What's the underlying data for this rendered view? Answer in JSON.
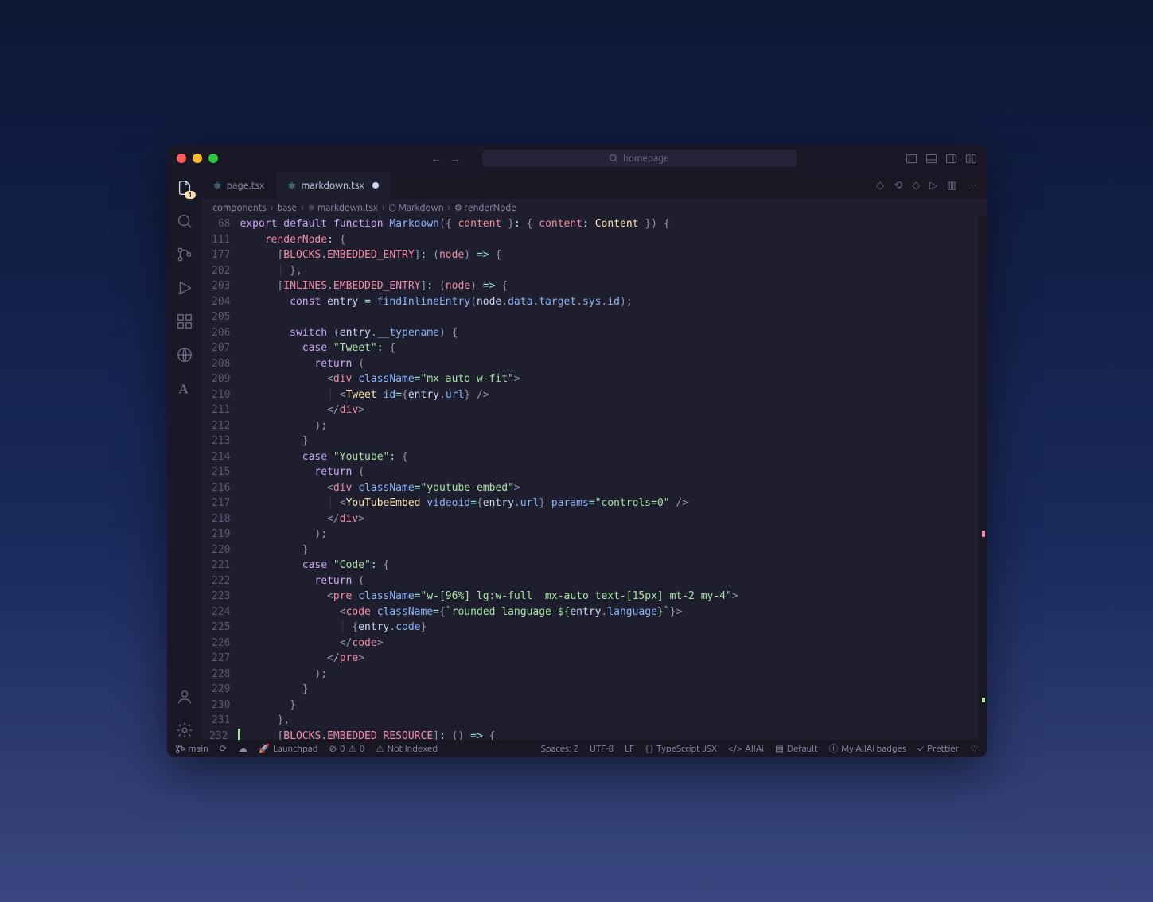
{
  "window": {
    "search_placeholder": "homepage"
  },
  "activity_badge": "1",
  "tabs": [
    {
      "label": "page.tsx",
      "active": false,
      "dirty": false
    },
    {
      "label": "markdown.tsx",
      "active": true,
      "dirty": true
    }
  ],
  "breadcrumbs": [
    "components",
    "base",
    "markdown.tsx",
    "Markdown",
    "renderNode"
  ],
  "code_lines": [
    {
      "n": 68,
      "html": "<span class='kw'>export</span> <span class='kw'>default</span> <span class='kw'>function</span> <span class='fn'>Markdown</span><span class='pun'>({</span> <span class='par'>content</span> <span class='pun'>}</span><span class='op'>:</span> <span class='pun'>{</span> <span class='id'>content</span><span class='op'>:</span> <span class='type'>Content</span> <span class='pun'>})</span> <span class='pun'>{</span>"
    },
    {
      "n": 111,
      "html": "    <span class='id'>renderNode</span><span class='op'>:</span> <span class='pun'>{</span>"
    },
    {
      "n": 177,
      "html": "      <span class='pun'>[</span><span class='id'>BLOCKS</span><span class='pun'>.</span><span class='id'>EMBEDDED_ENTRY</span><span class='pun'>]</span><span class='op'>:</span> <span class='pun'>(</span><span class='par'>node</span><span class='pun'>)</span> <span class='op'>=&gt;</span> <span class='pun'>{</span>"
    },
    {
      "n": 202,
      "html": "<span class='guide'>      │ </span><span class='pun'>},</span>"
    },
    {
      "n": 203,
      "html": "      <span class='pun'>[</span><span class='id'>INLINES</span><span class='pun'>.</span><span class='id'>EMBEDDED_ENTRY</span><span class='pun'>]</span><span class='op'>:</span> <span class='pun'>(</span><span class='par'>node</span><span class='pun'>)</span> <span class='op'>=&gt;</span> <span class='pun'>{</span>"
    },
    {
      "n": 204,
      "html": "        <span class='kw'>const</span> <span class='var'>entry</span> <span class='op'>=</span> <span class='fn'>findInlineEntry</span><span class='pun'>(</span><span class='var'>node</span><span class='pun'>.</span><span class='prop'>data</span><span class='pun'>.</span><span class='prop'>target</span><span class='pun'>.</span><span class='prop'>sys</span><span class='pun'>.</span><span class='prop'>id</span><span class='pun'>);</span>"
    },
    {
      "n": 205,
      "html": ""
    },
    {
      "n": 206,
      "html": "        <span class='kw'>switch</span> <span class='pun'>(</span><span class='var'>entry</span><span class='pun'>.</span><span class='prop'>__typename</span><span class='pun'>)</span> <span class='pun'>{</span>"
    },
    {
      "n": 207,
      "html": "          <span class='kw'>case</span> <span class='str'>\"Tweet\"</span><span class='op'>:</span> <span class='pun'>{</span>"
    },
    {
      "n": 208,
      "html": "            <span class='kw'>return</span> <span class='pun'>(</span>"
    },
    {
      "n": 209,
      "html": "              <span class='tagb'>&lt;</span><span class='tag'>div</span> <span class='attr'>className</span><span class='op'>=</span><span class='str'>\"mx-auto w-fit\"</span><span class='tagb'>&gt;</span>"
    },
    {
      "n": 210,
      "html": "<span class='guide'>              │ </span><span class='tagb'>&lt;</span><span class='type'>Tweet</span> <span class='attr'>id</span><span class='op'>=</span><span class='pun'>{</span><span class='var'>entry</span><span class='pun'>.</span><span class='prop'>url</span><span class='pun'>}</span> <span class='tagb'>/&gt;</span>"
    },
    {
      "n": 211,
      "html": "              <span class='tagb'>&lt;/</span><span class='tag'>div</span><span class='tagb'>&gt;</span>"
    },
    {
      "n": 212,
      "html": "            <span class='pun'>);</span>"
    },
    {
      "n": 213,
      "html": "          <span class='pun'>}</span>"
    },
    {
      "n": 214,
      "html": "          <span class='kw'>case</span> <span class='str'>\"Youtube\"</span><span class='op'>:</span> <span class='pun'>{</span>"
    },
    {
      "n": 215,
      "html": "            <span class='kw'>return</span> <span class='pun'>(</span>"
    },
    {
      "n": 216,
      "html": "              <span class='tagb'>&lt;</span><span class='tag'>div</span> <span class='attr'>className</span><span class='op'>=</span><span class='str'>\"youtube-embed\"</span><span class='tagb'>&gt;</span>"
    },
    {
      "n": 217,
      "html": "<span class='guide'>              │ </span><span class='tagb'>&lt;</span><span class='type'>YouTubeEmbed</span> <span class='attr'>videoid</span><span class='op'>=</span><span class='pun'>{</span><span class='var'>entry</span><span class='pun'>.</span><span class='prop'>url</span><span class='pun'>}</span> <span class='attr'>params</span><span class='op'>=</span><span class='str'>\"controls=0\"</span> <span class='tagb'>/&gt;</span>"
    },
    {
      "n": 218,
      "html": "              <span class='tagb'>&lt;/</span><span class='tag'>div</span><span class='tagb'>&gt;</span>"
    },
    {
      "n": 219,
      "html": "            <span class='pun'>);</span>"
    },
    {
      "n": 220,
      "html": "          <span class='pun'>}</span>"
    },
    {
      "n": 221,
      "html": "          <span class='kw'>case</span> <span class='str'>\"Code\"</span><span class='op'>:</span> <span class='pun'>{</span>"
    },
    {
      "n": 222,
      "html": "            <span class='kw'>return</span> <span class='pun'>(</span>"
    },
    {
      "n": 223,
      "html": "              <span class='tagb'>&lt;</span><span class='tag'>pre</span> <span class='attr'>className</span><span class='op'>=</span><span class='str'>\"w-[96%] lg:w-full  mx-auto text-[15px] mt-2 my-4\"</span><span class='tagb'>&gt;</span>"
    },
    {
      "n": 224,
      "html": "                <span class='tagb'>&lt;</span><span class='tag'>code</span> <span class='attr'>className</span><span class='op'>=</span><span class='pun'>{</span><span class='str'>`rounded language-${</span><span class='var'>entry</span><span class='pun'>.</span><span class='prop'>language</span><span class='str'>}`</span><span class='pun'>}</span><span class='tagb'>&gt;</span>"
    },
    {
      "n": 225,
      "html": "<span class='guide'>                │ </span><span class='pun'>{</span><span class='var'>entry</span><span class='pun'>.</span><span class='prop'>code</span><span class='pun'>}</span>"
    },
    {
      "n": 226,
      "html": "                <span class='tagb'>&lt;/</span><span class='tag'>code</span><span class='tagb'>&gt;</span>"
    },
    {
      "n": 227,
      "html": "              <span class='tagb'>&lt;/</span><span class='tag'>pre</span><span class='tagb'>&gt;</span>"
    },
    {
      "n": 228,
      "html": "            <span class='pun'>);</span>"
    },
    {
      "n": 229,
      "html": "          <span class='pun'>}</span>"
    },
    {
      "n": 230,
      "html": "        <span class='pun'>}</span>"
    },
    {
      "n": 231,
      "html": "      <span class='pun'>},</span>"
    },
    {
      "n": 232,
      "html": "      <span class='pun'>[</span><span class='id'>BLOCKS</span><span class='pun'>.</span><span class='id'>EMBEDDED_RESOURCE</span><span class='pun'>]</span><span class='op'>:</span> <span class='pun'>()</span> <span class='op'>=&gt;</span> <span class='pun'>{</span>",
      "diff": "green"
    }
  ],
  "status": {
    "branch": "main",
    "launchpad": "Launchpad",
    "errors": "0",
    "warnings": "0",
    "index": "Not Indexed",
    "spaces": "Spaces: 2",
    "encoding": "UTF-8",
    "eol": "LF",
    "lang": "TypeScript JSX",
    "aiiai": "AIIAi",
    "default": "Default",
    "badges": "My AIIAi badges",
    "prettier": "Prettier"
  }
}
